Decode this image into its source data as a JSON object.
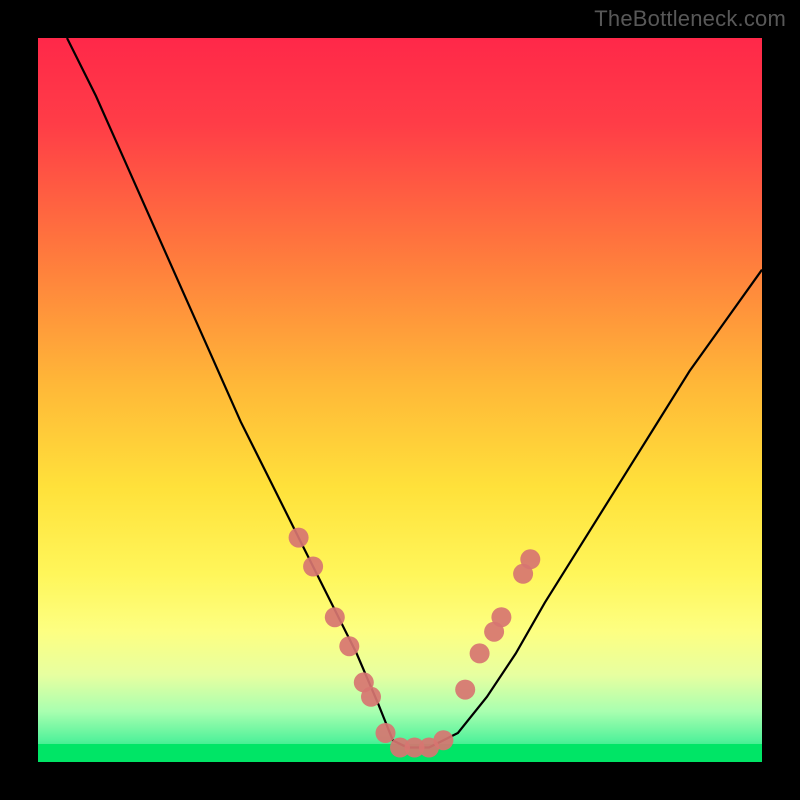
{
  "watermark": "TheBottleneck.com",
  "chart_data": {
    "type": "line",
    "title": "",
    "xlabel": "",
    "ylabel": "",
    "xlim": [
      0,
      100
    ],
    "ylim": [
      0,
      100
    ],
    "grid": false,
    "legend": false,
    "background": {
      "gradient_stops": [
        {
          "pct": 0,
          "color": "#ff2849"
        },
        {
          "pct": 12,
          "color": "#ff3d47"
        },
        {
          "pct": 30,
          "color": "#ff7a3d"
        },
        {
          "pct": 48,
          "color": "#ffb838"
        },
        {
          "pct": 62,
          "color": "#ffe13a"
        },
        {
          "pct": 74,
          "color": "#fff65a"
        },
        {
          "pct": 82,
          "color": "#fdff82"
        },
        {
          "pct": 88,
          "color": "#e7ffa0"
        },
        {
          "pct": 93,
          "color": "#a9ffb0"
        },
        {
          "pct": 97,
          "color": "#54f29b"
        },
        {
          "pct": 100,
          "color": "#00e566"
        }
      ],
      "bottom_strip_color": "#00e566"
    },
    "series": [
      {
        "name": "bottleneck-curve",
        "x": [
          4,
          8,
          12,
          16,
          20,
          24,
          28,
          32,
          36,
          40,
          44,
          47,
          49,
          51,
          54,
          58,
          62,
          66,
          70,
          75,
          80,
          85,
          90,
          95,
          100
        ],
        "y": [
          100,
          92,
          83,
          74,
          65,
          56,
          47,
          39,
          31,
          23,
          15,
          8,
          3,
          2,
          2,
          4,
          9,
          15,
          22,
          30,
          38,
          46,
          54,
          61,
          68
        ]
      }
    ],
    "markers": {
      "name": "highlight-dots",
      "color": "#d77571",
      "radius": 10,
      "points": [
        {
          "x": 36,
          "y": 31
        },
        {
          "x": 38,
          "y": 27
        },
        {
          "x": 41,
          "y": 20
        },
        {
          "x": 43,
          "y": 16
        },
        {
          "x": 45,
          "y": 11
        },
        {
          "x": 46,
          "y": 9
        },
        {
          "x": 48,
          "y": 4
        },
        {
          "x": 50,
          "y": 2
        },
        {
          "x": 52,
          "y": 2
        },
        {
          "x": 54,
          "y": 2
        },
        {
          "x": 56,
          "y": 3
        },
        {
          "x": 59,
          "y": 10
        },
        {
          "x": 61,
          "y": 15
        },
        {
          "x": 63,
          "y": 18
        },
        {
          "x": 64,
          "y": 20
        },
        {
          "x": 67,
          "y": 26
        },
        {
          "x": 68,
          "y": 28
        }
      ]
    }
  }
}
